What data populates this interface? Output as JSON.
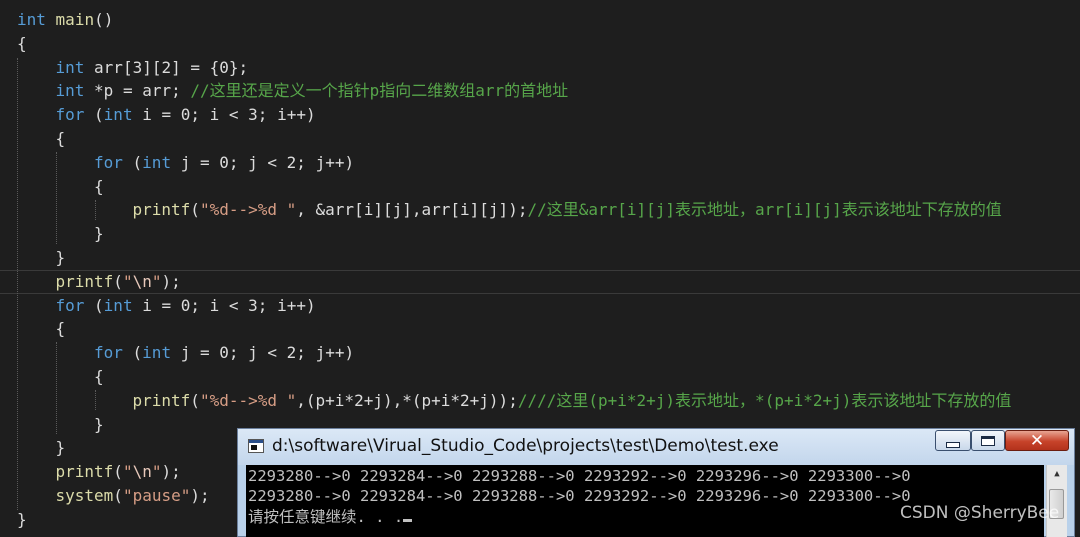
{
  "code_lines": [
    {
      "indent": 0,
      "tokens": [
        {
          "c": "kw",
          "t": "int"
        },
        {
          "c": "var",
          "t": " "
        },
        {
          "c": "fn",
          "t": "main"
        },
        {
          "c": "var",
          "t": "()"
        }
      ]
    },
    {
      "indent": 0,
      "tokens": [
        {
          "c": "var",
          "t": "{"
        }
      ]
    },
    {
      "indent": 1,
      "tokens": [
        {
          "c": "kw",
          "t": "int"
        },
        {
          "c": "var",
          "t": " arr[3][2] = {0};"
        }
      ]
    },
    {
      "indent": 1,
      "tokens": [
        {
          "c": "kw",
          "t": "int"
        },
        {
          "c": "var",
          "t": " *p = arr; "
        },
        {
          "c": "cm",
          "t": "//这里还是定义一个指针p指向二维数组arr的首地址"
        }
      ]
    },
    {
      "indent": 1,
      "tokens": [
        {
          "c": "kw",
          "t": "for"
        },
        {
          "c": "var",
          "t": " ("
        },
        {
          "c": "kw",
          "t": "int"
        },
        {
          "c": "var",
          "t": " i = 0; i < 3; i++)"
        }
      ]
    },
    {
      "indent": 1,
      "tokens": [
        {
          "c": "var",
          "t": "{"
        }
      ]
    },
    {
      "indent": 2,
      "tokens": [
        {
          "c": "kw",
          "t": "for"
        },
        {
          "c": "var",
          "t": " ("
        },
        {
          "c": "kw",
          "t": "int"
        },
        {
          "c": "var",
          "t": " j = 0; j < 2; j++)"
        }
      ]
    },
    {
      "indent": 2,
      "tokens": [
        {
          "c": "var",
          "t": "{"
        }
      ]
    },
    {
      "indent": 3,
      "tokens": [
        {
          "c": "fn",
          "t": "printf"
        },
        {
          "c": "var",
          "t": "("
        },
        {
          "c": "str",
          "t": "\"%d-->%d \""
        },
        {
          "c": "var",
          "t": ", &arr[i][j],arr[i][j]);"
        },
        {
          "c": "cm",
          "t": "//这里&arr[i][j]表示地址，arr[i][j]表示该地址下存放的值"
        }
      ]
    },
    {
      "indent": 2,
      "tokens": [
        {
          "c": "var",
          "t": "}"
        }
      ]
    },
    {
      "indent": 1,
      "tokens": [
        {
          "c": "var",
          "t": "}"
        }
      ]
    },
    {
      "indent": 1,
      "tokens": [
        {
          "c": "fn",
          "t": "printf"
        },
        {
          "c": "var",
          "t": "("
        },
        {
          "c": "str",
          "t": "\""
        },
        {
          "c": "esc",
          "t": "\\n"
        },
        {
          "c": "str",
          "t": "\""
        },
        {
          "c": "var",
          "t": ");"
        }
      ]
    },
    {
      "indent": 1,
      "tokens": [
        {
          "c": "kw",
          "t": "for"
        },
        {
          "c": "var",
          "t": " ("
        },
        {
          "c": "kw",
          "t": "int"
        },
        {
          "c": "var",
          "t": " i = 0; i < 3; i++)"
        }
      ]
    },
    {
      "indent": 1,
      "tokens": [
        {
          "c": "var",
          "t": "{"
        }
      ]
    },
    {
      "indent": 2,
      "tokens": [
        {
          "c": "kw",
          "t": "for"
        },
        {
          "c": "var",
          "t": " ("
        },
        {
          "c": "kw",
          "t": "int"
        },
        {
          "c": "var",
          "t": " j = 0; j < 2; j++)"
        }
      ]
    },
    {
      "indent": 2,
      "tokens": [
        {
          "c": "var",
          "t": "{"
        }
      ]
    },
    {
      "indent": 3,
      "tokens": [
        {
          "c": "fn",
          "t": "printf"
        },
        {
          "c": "var",
          "t": "("
        },
        {
          "c": "str",
          "t": "\"%d-->%d \""
        },
        {
          "c": "var",
          "t": ",(p+i*2+j),*(p+i*2+j));"
        },
        {
          "c": "cm",
          "t": "////这里(p+i*2+j)表示地址，*(p+i*2+j)表示该地址下存放的值"
        }
      ]
    },
    {
      "indent": 2,
      "tokens": [
        {
          "c": "var",
          "t": "}"
        }
      ]
    },
    {
      "indent": 1,
      "tokens": [
        {
          "c": "var",
          "t": "}"
        }
      ]
    },
    {
      "indent": 1,
      "tokens": [
        {
          "c": "fn",
          "t": "printf"
        },
        {
          "c": "var",
          "t": "("
        },
        {
          "c": "str",
          "t": "\""
        },
        {
          "c": "esc",
          "t": "\\n"
        },
        {
          "c": "str",
          "t": "\""
        },
        {
          "c": "var",
          "t": ");"
        }
      ]
    },
    {
      "indent": 1,
      "tokens": [
        {
          "c": "fn",
          "t": "system"
        },
        {
          "c": "var",
          "t": "("
        },
        {
          "c": "str",
          "t": "\"pause\""
        },
        {
          "c": "var",
          "t": ");"
        }
      ]
    },
    {
      "indent": 0,
      "tokens": [
        {
          "c": "var",
          "t": "}"
        }
      ]
    }
  ],
  "console": {
    "title": "d:\\software\\Virual_Studio_Code\\projects\\test\\Demo\\test.exe",
    "minimize_icon": "minimize-icon",
    "maximize_icon": "maximize-icon",
    "close_label": "✕",
    "output_lines": [
      "2293280-->0 2293284-->0 2293288-->0 2293292-->0 2293296-->0 2293300-->0",
      "2293280-->0 2293284-->0 2293288-->0 2293292-->0 2293296-->0 2293300-->0",
      "请按任意键继续. . ."
    ]
  },
  "watermark": "CSDN @SherryBee",
  "colors": {
    "background": "#1e1e1e",
    "keyword": "#569cd6",
    "string": "#d69d85",
    "comment": "#57a64a",
    "function": "#dcdcaa"
  }
}
